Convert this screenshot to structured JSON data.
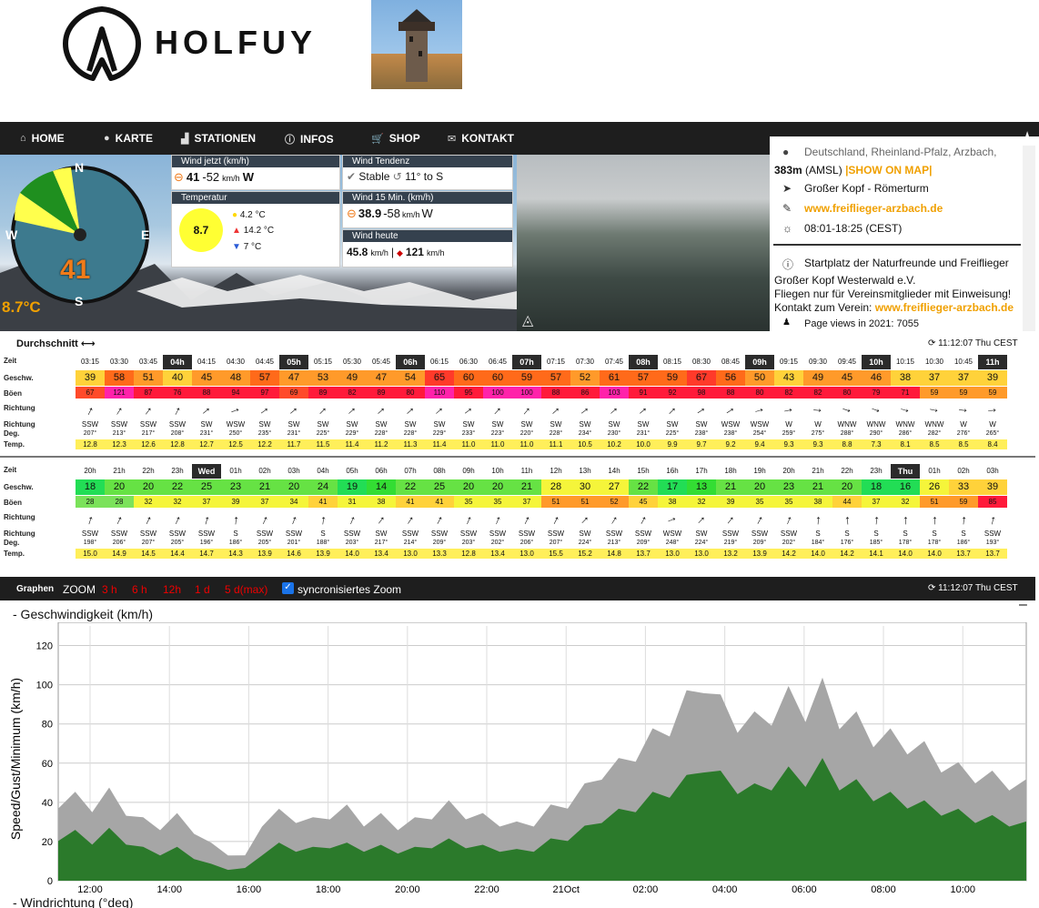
{
  "brand": {
    "name": "HOLFUY"
  },
  "nav": {
    "items": [
      {
        "label": "HOME",
        "icon": "home-icon"
      },
      {
        "label": "KARTE",
        "icon": "globe-icon"
      },
      {
        "label": "STATIONEN",
        "icon": "chart-icon"
      },
      {
        "label": "INFOS",
        "icon": "info-icon"
      },
      {
        "label": "SHOP",
        "icon": "cart-icon"
      },
      {
        "label": "KONTAKT",
        "icon": "mail-icon"
      }
    ],
    "favorite_icon": "star-icon"
  },
  "compass": {
    "speed": "41",
    "temp": "8.7°C",
    "north": "N",
    "east": "E",
    "south": "S",
    "west": "W"
  },
  "wind_now": {
    "title": "Wind jetzt (km/h)",
    "value": "41",
    "gust": "-52",
    "unit": "km/h",
    "dir": "W"
  },
  "temperature": {
    "title": "Temperatur",
    "current": "8.7",
    "avg": "4.2 °C",
    "max": "14.2 °C",
    "min": "7 °C"
  },
  "wind_trend": {
    "title": "Wind Tendenz",
    "state": "Stable",
    "turn": "11° to S"
  },
  "wind_15": {
    "title": "Wind 15 Min. (km/h)",
    "value": "38.9",
    "gust": "-58",
    "unit": "km/h",
    "dir": "W"
  },
  "wind_today": {
    "title": "Wind heute",
    "avg": "45.8",
    "unit": "km/h",
    "max_label": "121",
    "max_unit": "km/h"
  },
  "station": {
    "location": "Deutschland, Rheinland-Pfalz, Arzbach,",
    "altitude": "383m",
    "amsl": "(AMSL)",
    "show_map": "SHOW ON MAP",
    "name": "Großer Kopf - Römerturm",
    "link": "www.freiflieger-arzbach.de",
    "sun": "08:01-18:25 (CEST)",
    "info_title": "Startplatz der Naturfreunde und Freiflieger",
    "info_line1": "Großer Kopf Westerwald e.V.",
    "info_line2": "Fliegen nur für Vereinsmitglieder mit Einweisung!",
    "info_line3_pre": "Kontakt zum Verein:",
    "info_link": "www.freiflieger-arzbach.de",
    "pageviews": "Page views in 2021: 7055"
  },
  "history": {
    "title": "Durchschnitt",
    "updated": "11:12:07 Thu CEST",
    "row_labels": [
      "Zeit",
      "Geschw.",
      "Böen",
      "Richtung",
      "Richtung",
      "Temp."
    ],
    "times": [
      "03:15",
      "03:30",
      "03:45",
      "04h",
      "04:15",
      "04:30",
      "04:45",
      "05h",
      "05:15",
      "05:30",
      "05:45",
      "06h",
      "06:15",
      "06:30",
      "06:45",
      "07h",
      "07:15",
      "07:30",
      "07:45",
      "08h",
      "08:15",
      "08:30",
      "08:45",
      "09h",
      "09:15",
      "09:30",
      "09:45",
      "10h",
      "10:15",
      "10:30",
      "10:45",
      "11h"
    ],
    "speed": [
      39,
      58,
      51,
      40,
      45,
      48,
      57,
      47,
      53,
      49,
      47,
      54,
      65,
      60,
      60,
      59,
      57,
      52,
      61,
      57,
      59,
      67,
      56,
      50,
      43,
      49,
      45,
      46,
      38,
      37,
      37,
      39
    ],
    "gust": [
      67,
      121,
      87,
      76,
      88,
      94,
      97,
      69,
      89,
      82,
      89,
      80,
      110,
      95,
      100,
      100,
      88,
      86,
      103,
      91,
      92,
      98,
      88,
      80,
      82,
      82,
      80,
      79,
      71,
      59,
      59,
      59
    ],
    "dir": [
      "SSW",
      "SSW",
      "SSW",
      "SSW",
      "SW",
      "WSW",
      "SW",
      "SW",
      "SW",
      "SW",
      "SW",
      "SW",
      "SW",
      "SW",
      "SW",
      "SW",
      "SW",
      "SW",
      "SW",
      "SW",
      "SW",
      "SW",
      "WSW",
      "WSW",
      "W",
      "W",
      "WNW",
      "WNW",
      "WNW",
      "WNW",
      "W",
      "W"
    ],
    "deg": [
      207,
      213,
      217,
      208,
      231,
      250,
      235,
      231,
      225,
      229,
      228,
      228,
      229,
      233,
      223,
      220,
      228,
      234,
      230,
      231,
      225,
      238,
      238,
      254,
      259,
      275,
      288,
      290,
      286,
      282,
      276,
      265
    ],
    "temp": [
      "12.8",
      "12.3",
      "12.6",
      "12.8",
      "12.7",
      "12.5",
      "12.2",
      "11.7",
      "11.5",
      "11.4",
      "11.2",
      "11.3",
      "11.4",
      "11.0",
      "11.0",
      "11.0",
      "11.1",
      "10.5",
      "10.2",
      "10.0",
      "9.9",
      "9.7",
      "9.2",
      "9.4",
      "9.3",
      "9.3",
      "8.8",
      "7.3",
      "8.1",
      "8.5",
      "8.5",
      "8.4"
    ]
  },
  "forecast": {
    "times": [
      "20h",
      "21h",
      "22h",
      "23h",
      "Wed",
      "01h",
      "02h",
      "03h",
      "04h",
      "05h",
      "06h",
      "07h",
      "08h",
      "09h",
      "10h",
      "11h",
      "12h",
      "13h",
      "14h",
      "15h",
      "16h",
      "17h",
      "18h",
      "19h",
      "20h",
      "21h",
      "22h",
      "23h",
      "Thu",
      "01h",
      "02h",
      "03h"
    ],
    "speed": [
      18,
      20,
      20,
      22,
      25,
      23,
      21,
      20,
      24,
      19,
      14,
      22,
      25,
      20,
      20,
      21,
      28,
      30,
      27,
      22,
      17,
      13,
      21,
      20,
      23,
      21,
      20,
      18,
      16,
      26,
      33,
      39
    ],
    "gust": [
      28,
      28,
      32,
      32,
      37,
      39,
      37,
      34,
      41,
      31,
      38,
      41,
      41,
      35,
      35,
      37,
      51,
      51,
      52,
      45,
      38,
      32,
      39,
      35,
      35,
      38,
      44,
      37,
      32,
      51,
      59,
      85
    ],
    "dir": [
      "SSW",
      "SSW",
      "SSW",
      "SSW",
      "SSW",
      "S",
      "SSW",
      "SSW",
      "S",
      "SSW",
      "SW",
      "SSW",
      "SSW",
      "SSW",
      "SSW",
      "SSW",
      "SSW",
      "SW",
      "SSW",
      "SSW",
      "WSW",
      "SW",
      "SSW",
      "SSW",
      "SSW",
      "S",
      "S",
      "S",
      "S",
      "S",
      "S",
      "SSW"
    ],
    "deg": [
      198,
      206,
      207,
      205,
      196,
      186,
      205,
      201,
      188,
      203,
      217,
      214,
      209,
      203,
      202,
      206,
      207,
      224,
      213,
      209,
      248,
      224,
      219,
      209,
      202,
      184,
      176,
      185,
      178,
      178,
      186,
      193
    ],
    "temp": [
      "15.0",
      "14.9",
      "14.5",
      "14.4",
      "14.7",
      "14.3",
      "13.9",
      "14.6",
      "13.9",
      "14.0",
      "13.4",
      "13.0",
      "13.3",
      "12.8",
      "13.4",
      "13.0",
      "15.5",
      "15.2",
      "14.8",
      "13.7",
      "13.0",
      "13.0",
      "13.2",
      "13.9",
      "14.2",
      "14.0",
      "14.2",
      "14.1",
      "14.0",
      "14.0",
      "13.7",
      "13.7"
    ]
  },
  "graph_bar": {
    "title": "Graphen",
    "zoom": "ZOOM",
    "ranges": [
      "3 h",
      "6 h",
      "12h",
      "1 d",
      "5 d(max)"
    ],
    "sync": "syncronisiertes Zoom",
    "updated": "11:12:07 Thu CEST"
  },
  "chart_data": {
    "type": "area",
    "title": "- Geschwindigkeit (km/h)",
    "ylabel": "Speed/Gust/Minimum (km/h)",
    "ylim": [
      0,
      130
    ],
    "yticks": [
      0,
      20,
      40,
      60,
      80,
      100,
      120
    ],
    "xticks": [
      "12:00",
      "14:00",
      "16:00",
      "18:00",
      "20:00",
      "22:00",
      "21Oct",
      "02:00",
      "04:00",
      "06:00",
      "08:00",
      "10:00"
    ],
    "series": [
      {
        "name": "Gust",
        "color": "#a6a6a6",
        "values": [
          40,
          42,
          38,
          44,
          36,
          30,
          28,
          32,
          26,
          18,
          14,
          12,
          30,
          34,
          32,
          30,
          34,
          36,
          30,
          32,
          28,
          30,
          34,
          38,
          34,
          32,
          30,
          28,
          30,
          36,
          40,
          46,
          56,
          58,
          66,
          72,
          80,
          90,
          104,
          88,
          82,
          80,
          86,
          92,
          88,
          96,
          84,
          80,
          74,
          72,
          70,
          66,
          60,
          56,
          54,
          52,
          50,
          48
        ]
      },
      {
        "name": "Speed",
        "color": "#2b7a2b",
        "values": [
          22,
          24,
          20,
          25,
          20,
          16,
          14,
          16,
          12,
          8,
          6,
          6,
          14,
          18,
          16,
          16,
          18,
          18,
          16,
          17,
          15,
          16,
          18,
          20,
          18,
          17,
          16,
          15,
          16,
          20,
          22,
          26,
          32,
          34,
          38,
          42,
          46,
          50,
          60,
          52,
          48,
          46,
          50,
          54,
          52,
          58,
          50,
          48,
          44,
          42,
          40,
          38,
          36,
          34,
          32,
          31,
          30,
          28
        ]
      }
    ],
    "next_section": "- Windrichtung (°deg)"
  }
}
